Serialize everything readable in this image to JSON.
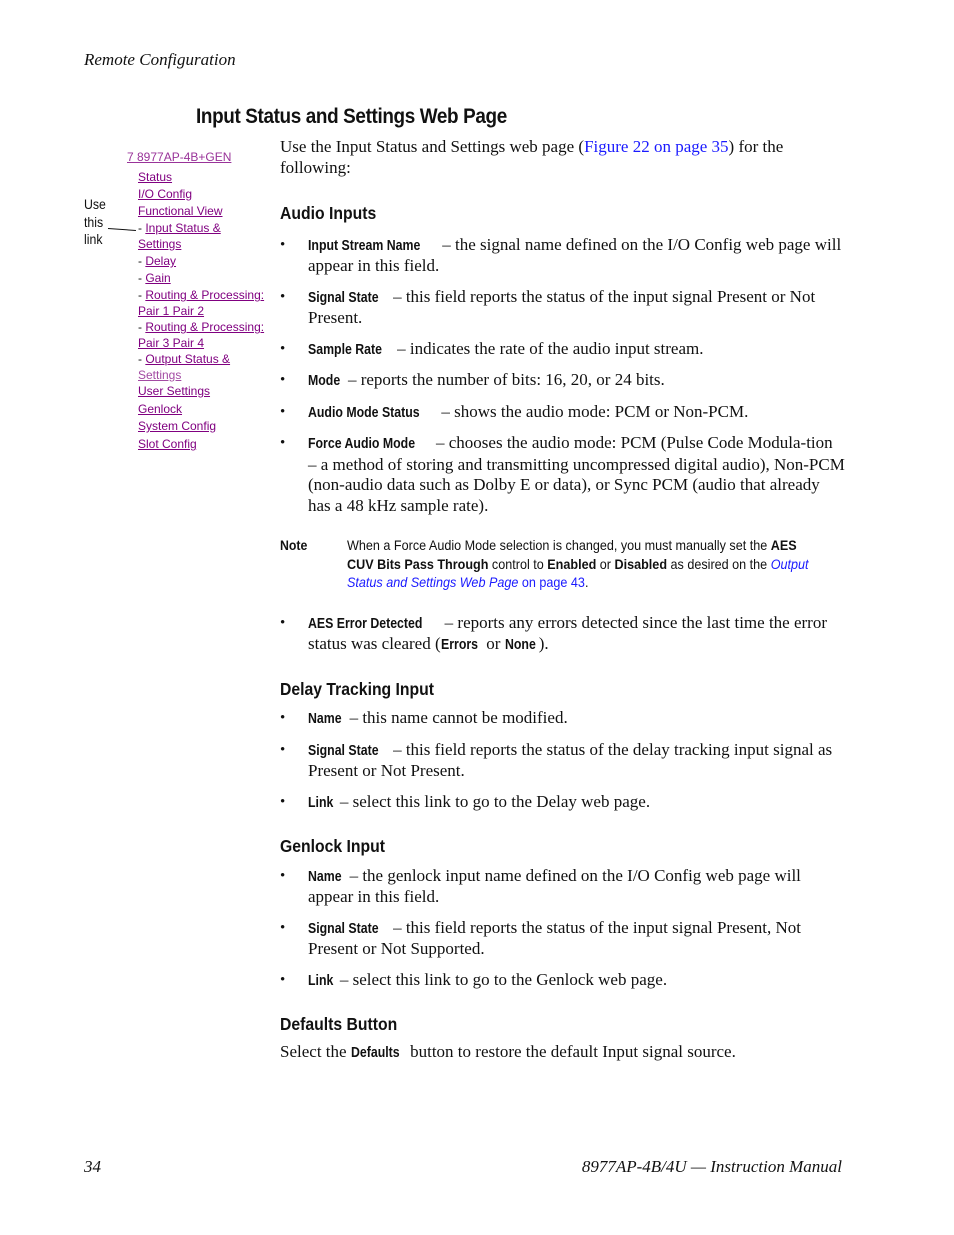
{
  "header": {
    "running_head": "Remote Configuration"
  },
  "section_title": "Input Status and Settings Web Page",
  "nav_figure": {
    "root": "7 8977AP-4B+GEN",
    "callout": [
      "Use",
      "this",
      "link"
    ],
    "items": [
      {
        "dash": "",
        "line1": "Status",
        "line2": ""
      },
      {
        "dash": "",
        "line1": "I/O Config",
        "line2": ""
      },
      {
        "dash": "",
        "line1": "Functional View",
        "line2": ""
      },
      {
        "dash": "- ",
        "line1": "Input Status &",
        "line2": "Settings"
      },
      {
        "dash": "- ",
        "line1": "Delay",
        "line2": ""
      },
      {
        "dash": "- ",
        "line1": "Gain",
        "line2": ""
      },
      {
        "dash": "- ",
        "line1": "Routing & Processing:",
        "line2": "Pair 1 Pair 2"
      },
      {
        "dash": "- ",
        "line1": "Routing & Processing:",
        "line2": "Pair 3 Pair 4"
      },
      {
        "dash": "- ",
        "line1": "Output Status &",
        "line2": "Settings"
      },
      {
        "dash": "",
        "line1": "User Settings",
        "line2": ""
      },
      {
        "dash": "",
        "line1": "Genlock",
        "line2": ""
      },
      {
        "dash": "",
        "line1": "System Config",
        "line2": ""
      },
      {
        "dash": "",
        "line1": "Slot Config",
        "line2": ""
      }
    ]
  },
  "intro": {
    "before": "Use the Input Status and Settings web page (",
    "link": "Figure 22 on page 35",
    "after": ") for the following:"
  },
  "audio_inputs": {
    "heading": "Audio Inputs",
    "items": [
      {
        "term": "Input Stream Name",
        "text": " – the signal name defined on the I/O Config web page will appear in this field."
      },
      {
        "term": "Signal State",
        "text": " – this field reports the status of the input signal Present or Not Present."
      },
      {
        "term": "Sample Rate",
        "text": " – indicates the rate of the audio input stream."
      },
      {
        "term": "Mode",
        "text": " – reports the number of bits: 16, 20, or 24 bits."
      },
      {
        "term": "Audio Mode Status",
        "text": " – shows the audio mode: PCM or Non-PCM."
      },
      {
        "term": "Force Audio Mode",
        "text": " – chooses the audio mode: PCM (Pulse Code Modula-tion – a method of storing and transmitting uncompressed digital audio), Non-PCM (non-audio data such as Dolby E or data), or Sync PCM (audio that already has a 48 kHz sample rate)."
      }
    ],
    "note": {
      "label": "Note",
      "t1": "When a Force Audio Mode selection is changed, you must manually set the ",
      "b1": "AES CUV Bits Pass Through",
      "t2": " control to ",
      "b2": "Enabled",
      "t3": " or ",
      "b3": "Disabled",
      "t4": " as desired on the ",
      "link_italic": "Output Status and Settings Web Page",
      "link_plain": " on page 43",
      "t5": "."
    },
    "aes_error": {
      "term": "AES Error Detected",
      "t1": " – reports any errors detected since the last time the error status was cleared (",
      "b1": "Errors",
      "t2": " or ",
      "b2": "None",
      "t3": ")."
    }
  },
  "delay_tracking": {
    "heading": "Delay Tracking Input",
    "items": [
      {
        "term": "Name",
        "text": " – this name cannot be modified."
      },
      {
        "term": "Signal State",
        "text": " – this field reports the status of the delay tracking input signal as Present or Not Present."
      },
      {
        "term": "Link",
        "text": " – select this link to go to the Delay web page."
      }
    ]
  },
  "genlock_input": {
    "heading": "Genlock Input",
    "items": [
      {
        "term": "Name",
        "text": " – the genlock input name defined on the I/O Config web page will appear in this field."
      },
      {
        "term": "Signal State",
        "text": " – this field reports the status of the input signal Present, Not Present or Not Supported."
      },
      {
        "term": "Link",
        "text": " – select this link to go to the Genlock web page."
      }
    ]
  },
  "defaults_button": {
    "heading": "Defaults Button",
    "t1": "Select the ",
    "b1": "Defaults",
    "t2": " button to restore the default Input signal source."
  },
  "footer": {
    "page_number": "34",
    "manual_title": "8977AP-4B/4U — Instruction Manual"
  }
}
